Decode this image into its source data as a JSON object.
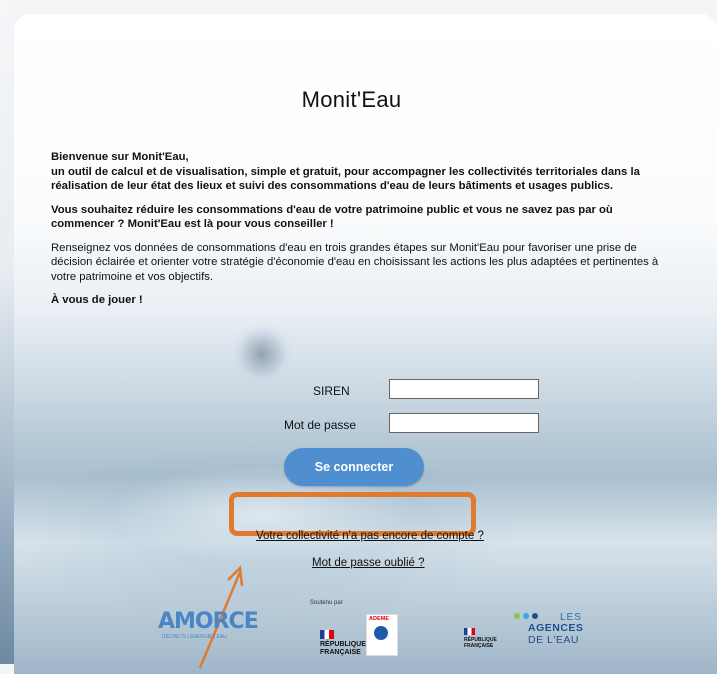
{
  "app": {
    "title": "Monit'Eau"
  },
  "intro": {
    "welcome": "Bienvenue sur Monit'Eau,",
    "description": "un outil de calcul et de visualisation, simple et gratuit, pour accompagner les collectivités territoriales dans la réalisation de leur état des lieux et suivi des consommations d'eau de leurs bâtiments et usages publics.",
    "question": "Vous souhaitez réduire les consommations d'eau de votre patrimoine public et vous ne savez pas par où commencer ? Monit'Eau est là pour vous conseiller !",
    "steps": "Renseignez vos données de consommations d'eau en trois grandes étapes sur Monit'Eau pour favoriser une prise de décision éclairée et orienter votre stratégie d'économie d'eau en choisissant les actions les plus adaptées et pertinentes à votre patrimoine et vos objectifs.",
    "cta": "À vous de jouer !"
  },
  "form": {
    "siren_label": "SIREN",
    "siren_value": "",
    "password_label": "Mot de passe",
    "password_value": "",
    "submit_label": "Se connecter"
  },
  "links": {
    "no_account": "Votre collectivité n'a pas encore de compte ?",
    "forgot_password": "Mot de passe oublié ?"
  },
  "footer": {
    "supported_by": "Soutenu par",
    "amorce": "AMORCE",
    "amorce_sub": "DÉCHETS | ÉNERGIE | EAU",
    "republique_1": "RÉPUBLIQUE",
    "republique_2": "FRANÇAISE",
    "ademe": "ADEME",
    "rf_small_1": "RÉPUBLIQUE",
    "rf_small_2": "FRANÇAISE",
    "agences_les": "LES",
    "agences_main": "AGENCES",
    "agences_sub": "DE L'EAU"
  },
  "colors": {
    "button": "#4f8fd0",
    "highlight": "#e07a2e"
  }
}
